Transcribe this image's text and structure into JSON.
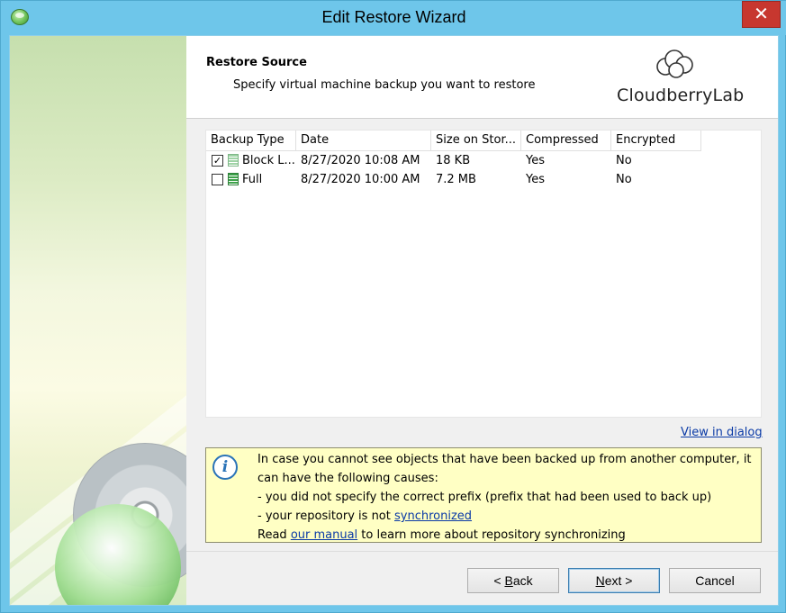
{
  "window": {
    "title": "Edit Restore Wizard",
    "close_glyph": "✕"
  },
  "header": {
    "title": "Restore Source",
    "subtitle": "Specify virtual machine backup you want to restore",
    "logo_text": "CloudberryLab"
  },
  "table": {
    "columns": [
      "Backup Type",
      "Date",
      "Size on Stor...",
      "Compressed",
      "Encrypted"
    ],
    "sorted_column": "Date",
    "rows": [
      {
        "checked": true,
        "check_glyph": "✓",
        "type": "Block L...",
        "date": "8/27/2020 10:08 AM",
        "size": "18 KB",
        "compressed": "Yes",
        "encrypted": "No",
        "icon": "block-level-backup-icon"
      },
      {
        "checked": false,
        "check_glyph": "",
        "type": "Full",
        "date": "8/27/2020 10:00 AM",
        "size": "7.2 MB",
        "compressed": "Yes",
        "encrypted": "No",
        "icon": "full-backup-icon"
      }
    ]
  },
  "view_in_dialog": "View in dialog",
  "info": {
    "line1": "In case you cannot see objects that have been backed up from another computer, it",
    "line2": "can have the following causes:",
    "line3": "- you did not specify the correct prefix (prefix that had been used to back up)",
    "line4_prefix": "- your repository is not ",
    "line4_link": "synchronized",
    "line5_prefix": "Read ",
    "line5_link": "our manual",
    "line5_suffix": " to learn more about repository synchronizing"
  },
  "buttons": {
    "back_prefix": "< ",
    "back_key": "B",
    "back_rest": "ack",
    "next_key": "N",
    "next_rest": "ext >",
    "cancel": "Cancel"
  },
  "colors": {
    "titlebar": "#6ec6ea",
    "close": "#c7372f",
    "info_bg": "#ffffc4",
    "link": "#0a3aa6"
  }
}
